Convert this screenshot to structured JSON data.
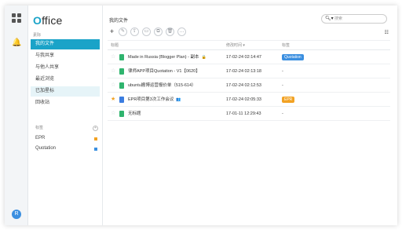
{
  "colors": {
    "accent": "#1aa3c8",
    "epr_tag": "#f2a223",
    "quotation_tag": "#3b8fe0"
  },
  "rail": {
    "apps_icon": "grid-icon",
    "notify_icon": "bell-icon",
    "avatar_text": "R"
  },
  "sidebar": {
    "logo_first": "O",
    "logo_rest": "ffice",
    "section_label": "素际",
    "items": [
      {
        "label": "我的文件"
      },
      {
        "label": "与我共享"
      },
      {
        "label": "与他人共享"
      },
      {
        "label": "最近浏览"
      },
      {
        "label": "已加星标"
      },
      {
        "label": "回收站"
      }
    ],
    "tags_label": "标签",
    "tags": [
      {
        "label": "EPR",
        "color": "#f2a223"
      },
      {
        "label": "Quotation",
        "color": "#3b8fe0"
      }
    ]
  },
  "main": {
    "title": "我的文件",
    "search_placeholder": "搜索",
    "toolbar": [
      "+",
      "✎",
      "⇪",
      "▭",
      "⧉",
      "🗑",
      "…"
    ],
    "columns": {
      "name": "标题",
      "time": "修改时间 ▾",
      "tag": "标签"
    },
    "files": [
      {
        "name": "Made in Russia (Blogger Plan) - 副本",
        "time": "17-02-24 02:14:47",
        "tag": "Quotation",
        "tag_color": "#3b8fe0",
        "starred": false,
        "icon": "green",
        "lock": "🔒"
      },
      {
        "name": "律师APP项目Quotation - V1【0620】",
        "time": "17-02-24 02:13:18",
        "tag": "-",
        "starred": false,
        "icon": "green"
      },
      {
        "name": "ubuntu搬博运营报价单（515-614）",
        "time": "17-02-24 02:12:53",
        "tag": "-",
        "starred": false,
        "icon": "green"
      },
      {
        "name": "EPR项目第3次工作会议",
        "time": "17-02-24 02:05:33",
        "tag": "EPR",
        "tag_color": "#f2a223",
        "starred": true,
        "icon": "blue",
        "lock": "👥"
      },
      {
        "name": "无标题",
        "time": "17-01-11 12:29:43",
        "tag": "-",
        "starred": false,
        "icon": "green"
      }
    ]
  }
}
